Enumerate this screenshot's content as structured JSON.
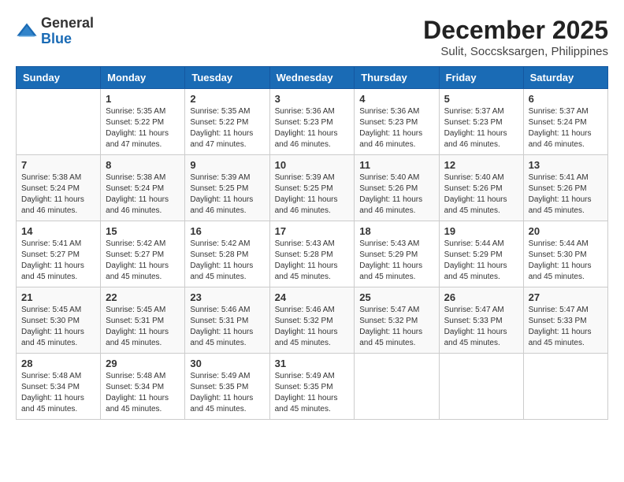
{
  "header": {
    "logo": {
      "line1": "General",
      "line2": "Blue"
    },
    "title": "December 2025",
    "location": "Sulit, Soccsksargen, Philippines"
  },
  "days_of_week": [
    "Sunday",
    "Monday",
    "Tuesday",
    "Wednesday",
    "Thursday",
    "Friday",
    "Saturday"
  ],
  "weeks": [
    [
      {
        "day": "",
        "info": ""
      },
      {
        "day": "1",
        "info": "Sunrise: 5:35 AM\nSunset: 5:22 PM\nDaylight: 11 hours and 47 minutes."
      },
      {
        "day": "2",
        "info": "Sunrise: 5:35 AM\nSunset: 5:22 PM\nDaylight: 11 hours and 47 minutes."
      },
      {
        "day": "3",
        "info": "Sunrise: 5:36 AM\nSunset: 5:23 PM\nDaylight: 11 hours and 46 minutes."
      },
      {
        "day": "4",
        "info": "Sunrise: 5:36 AM\nSunset: 5:23 PM\nDaylight: 11 hours and 46 minutes."
      },
      {
        "day": "5",
        "info": "Sunrise: 5:37 AM\nSunset: 5:23 PM\nDaylight: 11 hours and 46 minutes."
      },
      {
        "day": "6",
        "info": "Sunrise: 5:37 AM\nSunset: 5:24 PM\nDaylight: 11 hours and 46 minutes."
      }
    ],
    [
      {
        "day": "7",
        "info": "Sunrise: 5:38 AM\nSunset: 5:24 PM\nDaylight: 11 hours and 46 minutes."
      },
      {
        "day": "8",
        "info": "Sunrise: 5:38 AM\nSunset: 5:24 PM\nDaylight: 11 hours and 46 minutes."
      },
      {
        "day": "9",
        "info": "Sunrise: 5:39 AM\nSunset: 5:25 PM\nDaylight: 11 hours and 46 minutes."
      },
      {
        "day": "10",
        "info": "Sunrise: 5:39 AM\nSunset: 5:25 PM\nDaylight: 11 hours and 46 minutes."
      },
      {
        "day": "11",
        "info": "Sunrise: 5:40 AM\nSunset: 5:26 PM\nDaylight: 11 hours and 46 minutes."
      },
      {
        "day": "12",
        "info": "Sunrise: 5:40 AM\nSunset: 5:26 PM\nDaylight: 11 hours and 45 minutes."
      },
      {
        "day": "13",
        "info": "Sunrise: 5:41 AM\nSunset: 5:26 PM\nDaylight: 11 hours and 45 minutes."
      }
    ],
    [
      {
        "day": "14",
        "info": "Sunrise: 5:41 AM\nSunset: 5:27 PM\nDaylight: 11 hours and 45 minutes."
      },
      {
        "day": "15",
        "info": "Sunrise: 5:42 AM\nSunset: 5:27 PM\nDaylight: 11 hours and 45 minutes."
      },
      {
        "day": "16",
        "info": "Sunrise: 5:42 AM\nSunset: 5:28 PM\nDaylight: 11 hours and 45 minutes."
      },
      {
        "day": "17",
        "info": "Sunrise: 5:43 AM\nSunset: 5:28 PM\nDaylight: 11 hours and 45 minutes."
      },
      {
        "day": "18",
        "info": "Sunrise: 5:43 AM\nSunset: 5:29 PM\nDaylight: 11 hours and 45 minutes."
      },
      {
        "day": "19",
        "info": "Sunrise: 5:44 AM\nSunset: 5:29 PM\nDaylight: 11 hours and 45 minutes."
      },
      {
        "day": "20",
        "info": "Sunrise: 5:44 AM\nSunset: 5:30 PM\nDaylight: 11 hours and 45 minutes."
      }
    ],
    [
      {
        "day": "21",
        "info": "Sunrise: 5:45 AM\nSunset: 5:30 PM\nDaylight: 11 hours and 45 minutes."
      },
      {
        "day": "22",
        "info": "Sunrise: 5:45 AM\nSunset: 5:31 PM\nDaylight: 11 hours and 45 minutes."
      },
      {
        "day": "23",
        "info": "Sunrise: 5:46 AM\nSunset: 5:31 PM\nDaylight: 11 hours and 45 minutes."
      },
      {
        "day": "24",
        "info": "Sunrise: 5:46 AM\nSunset: 5:32 PM\nDaylight: 11 hours and 45 minutes."
      },
      {
        "day": "25",
        "info": "Sunrise: 5:47 AM\nSunset: 5:32 PM\nDaylight: 11 hours and 45 minutes."
      },
      {
        "day": "26",
        "info": "Sunrise: 5:47 AM\nSunset: 5:33 PM\nDaylight: 11 hours and 45 minutes."
      },
      {
        "day": "27",
        "info": "Sunrise: 5:47 AM\nSunset: 5:33 PM\nDaylight: 11 hours and 45 minutes."
      }
    ],
    [
      {
        "day": "28",
        "info": "Sunrise: 5:48 AM\nSunset: 5:34 PM\nDaylight: 11 hours and 45 minutes."
      },
      {
        "day": "29",
        "info": "Sunrise: 5:48 AM\nSunset: 5:34 PM\nDaylight: 11 hours and 45 minutes."
      },
      {
        "day": "30",
        "info": "Sunrise: 5:49 AM\nSunset: 5:35 PM\nDaylight: 11 hours and 45 minutes."
      },
      {
        "day": "31",
        "info": "Sunrise: 5:49 AM\nSunset: 5:35 PM\nDaylight: 11 hours and 45 minutes."
      },
      {
        "day": "",
        "info": ""
      },
      {
        "day": "",
        "info": ""
      },
      {
        "day": "",
        "info": ""
      }
    ]
  ]
}
